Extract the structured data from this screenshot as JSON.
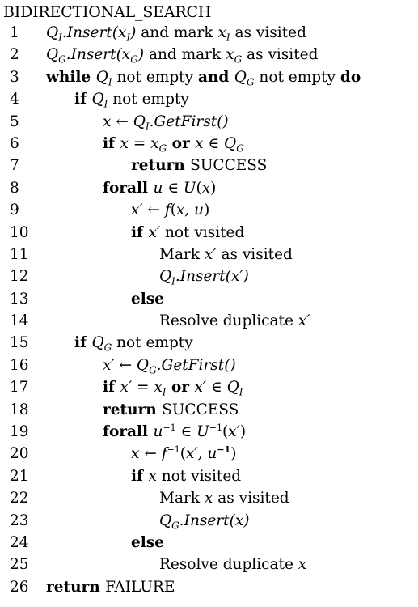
{
  "title": "BIDIRECTIONAL_SEARCH",
  "lines": [
    {
      "num": "1",
      "indent": 0,
      "segs": [
        {
          "t": "Q",
          "c": "it"
        },
        {
          "t": "I",
          "c": "it",
          "sub": true
        },
        {
          "t": ".Insert(x",
          "c": "it"
        },
        {
          "t": "I",
          "c": "it",
          "sub": true
        },
        {
          "t": ")",
          "c": "it"
        },
        {
          "t": " and mark ",
          "c": ""
        },
        {
          "t": "x",
          "c": "it"
        },
        {
          "t": "I",
          "c": "it",
          "sub": true
        },
        {
          "t": " as visited",
          "c": ""
        }
      ]
    },
    {
      "num": "2",
      "indent": 0,
      "segs": [
        {
          "t": "Q",
          "c": "it"
        },
        {
          "t": "G",
          "c": "it",
          "sub": true
        },
        {
          "t": ".Insert(x",
          "c": "it"
        },
        {
          "t": "G",
          "c": "it",
          "sub": true
        },
        {
          "t": ")",
          "c": "it"
        },
        {
          "t": " and mark ",
          "c": ""
        },
        {
          "t": "x",
          "c": "it"
        },
        {
          "t": "G",
          "c": "it",
          "sub": true
        },
        {
          "t": " as visited",
          "c": ""
        }
      ]
    },
    {
      "num": "3",
      "indent": 0,
      "segs": [
        {
          "t": "while ",
          "c": "kw"
        },
        {
          "t": "Q",
          "c": "it"
        },
        {
          "t": "I",
          "c": "it",
          "sub": true
        },
        {
          "t": " not empty ",
          "c": ""
        },
        {
          "t": "and ",
          "c": "kw"
        },
        {
          "t": "Q",
          "c": "it"
        },
        {
          "t": "G",
          "c": "it",
          "sub": true
        },
        {
          "t": " not empty ",
          "c": ""
        },
        {
          "t": "do",
          "c": "kw"
        }
      ]
    },
    {
      "num": "4",
      "indent": 1,
      "segs": [
        {
          "t": "if ",
          "c": "kw"
        },
        {
          "t": "Q",
          "c": "it"
        },
        {
          "t": "I",
          "c": "it",
          "sub": true
        },
        {
          "t": " not empty",
          "c": ""
        }
      ]
    },
    {
      "num": "5",
      "indent": 2,
      "segs": [
        {
          "t": "x",
          "c": "it"
        },
        {
          "t": " ← ",
          "c": ""
        },
        {
          "t": "Q",
          "c": "it"
        },
        {
          "t": "I",
          "c": "it",
          "sub": true
        },
        {
          "t": ".GetFirst()",
          "c": "it"
        }
      ]
    },
    {
      "num": "6",
      "indent": 2,
      "segs": [
        {
          "t": "if ",
          "c": "kw"
        },
        {
          "t": "x",
          "c": "it"
        },
        {
          "t": " = ",
          "c": ""
        },
        {
          "t": "x",
          "c": "it"
        },
        {
          "t": "G",
          "c": "it",
          "sub": true
        },
        {
          "t": " or ",
          "c": "kw"
        },
        {
          "t": "x",
          "c": "it"
        },
        {
          "t": " ∈ ",
          "c": ""
        },
        {
          "t": "Q",
          "c": "it"
        },
        {
          "t": "G",
          "c": "it",
          "sub": true
        }
      ]
    },
    {
      "num": "7",
      "indent": 3,
      "segs": [
        {
          "t": "return ",
          "c": "kw"
        },
        {
          "t": "SUCCESS",
          "c": ""
        }
      ]
    },
    {
      "num": "8",
      "indent": 2,
      "segs": [
        {
          "t": "forall ",
          "c": "kw"
        },
        {
          "t": "u",
          "c": "it"
        },
        {
          "t": " ∈ ",
          "c": ""
        },
        {
          "t": "U",
          "c": "it"
        },
        {
          "t": "(",
          "c": ""
        },
        {
          "t": "x",
          "c": "it"
        },
        {
          "t": ")",
          "c": ""
        }
      ]
    },
    {
      "num": "9",
      "indent": 3,
      "segs": [
        {
          "t": "x′",
          "c": "it"
        },
        {
          "t": " ← ",
          "c": ""
        },
        {
          "t": "f",
          "c": "it"
        },
        {
          "t": "(",
          "c": ""
        },
        {
          "t": "x, u",
          "c": "it"
        },
        {
          "t": ")",
          "c": ""
        }
      ]
    },
    {
      "num": "10",
      "indent": 3,
      "segs": [
        {
          "t": "if ",
          "c": "kw"
        },
        {
          "t": "x′",
          "c": "it"
        },
        {
          "t": " not visited",
          "c": ""
        }
      ]
    },
    {
      "num": "11",
      "indent": 4,
      "segs": [
        {
          "t": "Mark ",
          "c": ""
        },
        {
          "t": "x′",
          "c": "it"
        },
        {
          "t": " as visited",
          "c": ""
        }
      ]
    },
    {
      "num": "12",
      "indent": 4,
      "segs": [
        {
          "t": "Q",
          "c": "it"
        },
        {
          "t": "I",
          "c": "it",
          "sub": true
        },
        {
          "t": ".Insert(x′)",
          "c": "it"
        }
      ]
    },
    {
      "num": "13",
      "indent": 3,
      "segs": [
        {
          "t": "else",
          "c": "kw"
        }
      ]
    },
    {
      "num": "14",
      "indent": 4,
      "segs": [
        {
          "t": "Resolve duplicate ",
          "c": ""
        },
        {
          "t": "x′",
          "c": "it"
        }
      ]
    },
    {
      "num": "15",
      "indent": 1,
      "segs": [
        {
          "t": "if ",
          "c": "kw"
        },
        {
          "t": "Q",
          "c": "it"
        },
        {
          "t": "G",
          "c": "it",
          "sub": true
        },
        {
          "t": " not empty",
          "c": ""
        }
      ]
    },
    {
      "num": "16",
      "indent": 2,
      "segs": [
        {
          "t": "x′",
          "c": "it"
        },
        {
          "t": " ← ",
          "c": ""
        },
        {
          "t": "Q",
          "c": "it"
        },
        {
          "t": "G",
          "c": "it",
          "sub": true
        },
        {
          "t": ".GetFirst()",
          "c": "it"
        }
      ]
    },
    {
      "num": "17",
      "indent": 2,
      "segs": [
        {
          "t": "if ",
          "c": "kw"
        },
        {
          "t": "x′",
          "c": "it"
        },
        {
          "t": " = ",
          "c": ""
        },
        {
          "t": "x",
          "c": "it"
        },
        {
          "t": "I",
          "c": "it",
          "sub": true
        },
        {
          "t": " or ",
          "c": "kw"
        },
        {
          "t": "x′",
          "c": "it"
        },
        {
          "t": " ∈ ",
          "c": ""
        },
        {
          "t": "Q",
          "c": "it"
        },
        {
          "t": "I",
          "c": "it",
          "sub": true
        }
      ]
    },
    {
      "num": "18",
      "indent": 2,
      "segs": [
        {
          "t": "return ",
          "c": "kw"
        },
        {
          "t": "SUCCESS",
          "c": ""
        }
      ]
    },
    {
      "num": "19",
      "indent": 2,
      "segs": [
        {
          "t": "forall ",
          "c": "kw"
        },
        {
          "t": "u",
          "c": "it"
        },
        {
          "t": "−1",
          "c": "",
          "sup": true
        },
        {
          "t": " ∈ ",
          "c": ""
        },
        {
          "t": "U",
          "c": "it"
        },
        {
          "t": "−1",
          "c": "",
          "sup": true
        },
        {
          "t": "(",
          "c": ""
        },
        {
          "t": "x′",
          "c": "it"
        },
        {
          "t": ")",
          "c": ""
        }
      ]
    },
    {
      "num": "20",
      "indent": 3,
      "segs": [
        {
          "t": "x",
          "c": "it"
        },
        {
          "t": " ← ",
          "c": ""
        },
        {
          "t": "f",
          "c": "it"
        },
        {
          "t": "−1",
          "c": "",
          "sup": true
        },
        {
          "t": "(",
          "c": ""
        },
        {
          "t": "x′, u",
          "c": "it"
        },
        {
          "t": "−1",
          "c": "kw",
          "sup": true
        },
        {
          "t": ")",
          "c": ""
        }
      ]
    },
    {
      "num": "21",
      "indent": 3,
      "segs": [
        {
          "t": "if ",
          "c": "kw"
        },
        {
          "t": "x",
          "c": "it"
        },
        {
          "t": " not visited",
          "c": ""
        }
      ]
    },
    {
      "num": "22",
      "indent": 4,
      "segs": [
        {
          "t": "Mark ",
          "c": ""
        },
        {
          "t": "x",
          "c": "it"
        },
        {
          "t": " as visited",
          "c": ""
        }
      ]
    },
    {
      "num": "23",
      "indent": 4,
      "segs": [
        {
          "t": "Q",
          "c": "it"
        },
        {
          "t": "G",
          "c": "it",
          "sub": true
        },
        {
          "t": ".Insert(x)",
          "c": "it"
        }
      ]
    },
    {
      "num": "24",
      "indent": 3,
      "segs": [
        {
          "t": "else",
          "c": "kw"
        }
      ]
    },
    {
      "num": "25",
      "indent": 4,
      "segs": [
        {
          "t": "Resolve duplicate ",
          "c": ""
        },
        {
          "t": "x",
          "c": "it"
        }
      ]
    },
    {
      "num": "26",
      "indent": 0,
      "segs": [
        {
          "t": "return ",
          "c": "kw"
        },
        {
          "t": "FAILURE",
          "c": ""
        }
      ]
    }
  ]
}
